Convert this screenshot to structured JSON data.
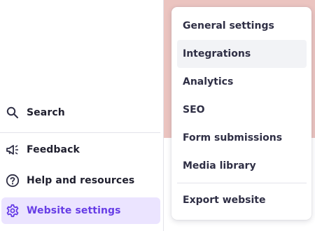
{
  "sidebar": {
    "items": [
      {
        "label": "Search",
        "icon": "search-icon"
      },
      {
        "label": "Feedback",
        "icon": "megaphone-icon"
      },
      {
        "label": "Help and resources",
        "icon": "help-circle-icon"
      },
      {
        "label": "Website settings",
        "icon": "gear-icon",
        "active": true
      }
    ]
  },
  "menu": {
    "items": [
      {
        "label": "General settings"
      },
      {
        "label": "Integrations",
        "hovered": true
      },
      {
        "label": "Analytics"
      },
      {
        "label": "SEO"
      },
      {
        "label": "Form submissions"
      },
      {
        "label": "Media library"
      },
      {
        "label": "Export website"
      }
    ]
  },
  "colors": {
    "accent": "#673de6",
    "active_bg": "#ebe4ff",
    "preview_bg": "#ebc4c0",
    "hover_bg": "#f2f3f6"
  }
}
